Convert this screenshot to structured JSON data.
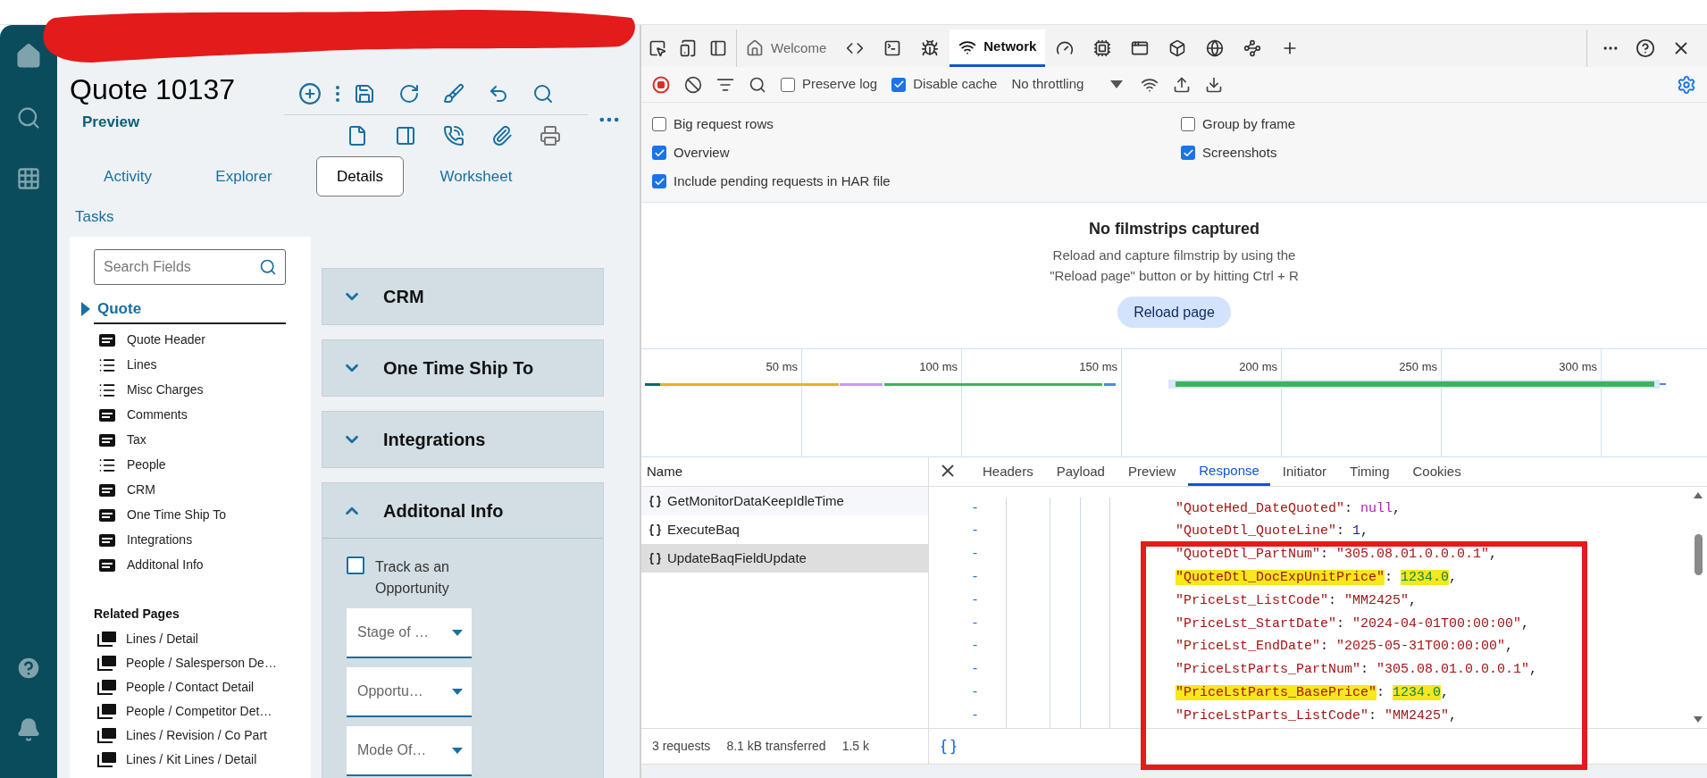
{
  "app": {
    "title": "Quote 10137",
    "subtitle": "Preview",
    "tabs": [
      {
        "label": "Activity",
        "selected": false
      },
      {
        "label": "Explorer",
        "selected": false
      },
      {
        "label": "Details",
        "selected": true
      },
      {
        "label": "Worksheet",
        "selected": false
      },
      {
        "label": "Tasks",
        "selected": false
      }
    ],
    "search": {
      "placeholder": "Search Fields"
    },
    "section": "Quote",
    "fields": [
      {
        "label": "Quote Header",
        "kind": "form"
      },
      {
        "label": "Lines",
        "kind": "list"
      },
      {
        "label": "Misc Charges",
        "kind": "list"
      },
      {
        "label": "Comments",
        "kind": "form"
      },
      {
        "label": "Tax",
        "kind": "form"
      },
      {
        "label": "People",
        "kind": "list"
      },
      {
        "label": "CRM",
        "kind": "form"
      },
      {
        "label": "One Time Ship To",
        "kind": "form"
      },
      {
        "label": "Integrations",
        "kind": "form"
      },
      {
        "label": "Additonal Info",
        "kind": "form"
      }
    ],
    "related_title": "Related Pages",
    "related": [
      "Lines / Detail",
      "People / Salesperson De…",
      "People / Contact Detail",
      "People / Competitor Det…",
      "Lines / Revision / Co Part",
      "Lines / Kit Lines / Detail"
    ],
    "cards": [
      {
        "title": "CRM",
        "expanded": false
      },
      {
        "title": "One Time Ship To",
        "expanded": false
      },
      {
        "title": "Integrations",
        "expanded": false
      },
      {
        "title": "Additonal Info",
        "expanded": true
      }
    ],
    "additional": {
      "checkbox": {
        "label": "Track as an Opportunity",
        "checked": false
      },
      "dropdowns": [
        {
          "placeholder": "Stage of …"
        },
        {
          "placeholder": "Opportu…"
        },
        {
          "placeholder": "Mode Of…"
        }
      ]
    }
  },
  "devtools": {
    "tabs": [
      {
        "label": "Welcome",
        "selected": false
      },
      {
        "label": "Network",
        "selected": true
      }
    ],
    "toolbar": {
      "preserve_log": {
        "label": "Preserve log",
        "checked": false
      },
      "disable_cache": {
        "label": "Disable cache",
        "checked": true
      },
      "throttling": "No throttling"
    },
    "settings": [
      {
        "label": "Big request rows",
        "checked": false
      },
      {
        "label": "Group by frame",
        "checked": false
      },
      {
        "label": "Overview",
        "checked": true
      },
      {
        "label": "Screenshots",
        "checked": true
      },
      {
        "label": "Include pending requests in HAR file",
        "checked": true
      }
    ],
    "filmstrip": {
      "title": "No filmstrips captured",
      "message": "Reload and capture filmstrip by using the \"Reload page\" button or by hitting Ctrl + R",
      "button": "Reload page"
    },
    "timeline_ticks": [
      "50 ms",
      "100 ms",
      "150 ms",
      "200 ms",
      "250 ms",
      "300 ms"
    ],
    "name_header": "Name",
    "requests": [
      {
        "name": "GetMonitorDataKeepIdleTime",
        "selected": false
      },
      {
        "name": "ExecuteBaq",
        "selected": false
      },
      {
        "name": "UpdateBaqFieldUpdate",
        "selected": true
      }
    ],
    "footer": [
      "3 requests",
      "8.1 kB transferred",
      "1.5 k"
    ],
    "detail_tabs": [
      {
        "label": "Headers",
        "selected": false
      },
      {
        "label": "Payload",
        "selected": false
      },
      {
        "label": "Preview",
        "selected": false
      },
      {
        "label": "Response",
        "selected": true
      },
      {
        "label": "Initiator",
        "selected": false
      },
      {
        "label": "Timing",
        "selected": false
      },
      {
        "label": "Cookies",
        "selected": false
      }
    ],
    "response_lines": [
      {
        "marker": "-",
        "key": "\"QuoteHed_DateQuoted\"",
        "sep": ": ",
        "value": "null",
        "end": ",",
        "kind": "keyword",
        "highlighted": false
      },
      {
        "marker": "-",
        "key": "\"QuoteDtl_QuoteLine\"",
        "sep": ": ",
        "value": "1",
        "end": ",",
        "kind": "int",
        "highlighted": false
      },
      {
        "marker": "-",
        "key": "\"QuoteDtl_PartNum\"",
        "sep": ": ",
        "value": "\"305.08.01.0.0.0.1\"",
        "end": ",",
        "kind": "string",
        "highlighted": false
      },
      {
        "marker": "-",
        "key": "\"QuoteDtl_DocExpUnitPrice\"",
        "sep": ": ",
        "value": "1234.0",
        "end": ",",
        "kind": "float",
        "highlighted": true
      },
      {
        "marker": "-",
        "key": "\"PriceLst_ListCode\"",
        "sep": ": ",
        "value": "\"MM2425\"",
        "end": ",",
        "kind": "string",
        "highlighted": false
      },
      {
        "marker": "-",
        "key": "\"PriceLst_StartDate\"",
        "sep": ": ",
        "value": "\"2024-04-01T00:00:00\"",
        "end": ",",
        "kind": "string",
        "highlighted": false
      },
      {
        "marker": "-",
        "key": "\"PriceLst_EndDate\"",
        "sep": ": ",
        "value": "\"2025-05-31T00:00:00\"",
        "end": ",",
        "kind": "string",
        "highlighted": false
      },
      {
        "marker": "-",
        "key": "\"PriceLstParts_PartNum\"",
        "sep": ": ",
        "value": "\"305.08.01.0.0.0.1\"",
        "end": ",",
        "kind": "string",
        "highlighted": false
      },
      {
        "marker": "-",
        "key": "\"PriceLstParts_BasePrice\"",
        "sep": ": ",
        "value": "1234.0",
        "end": ",",
        "kind": "float",
        "highlighted": true
      },
      {
        "marker": "-",
        "key": "\"PriceLstParts_ListCode\"",
        "sep": ": ",
        "value": "\"MM2425\"",
        "end": ",",
        "kind": "string",
        "highlighted": false
      }
    ]
  }
}
